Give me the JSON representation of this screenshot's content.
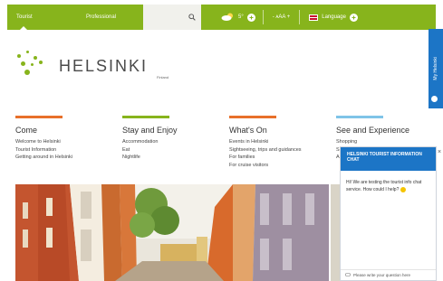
{
  "topbar": {
    "tabs": [
      {
        "label": "Tourist"
      },
      {
        "label": "Professional"
      }
    ],
    "search": {
      "placeholder": ""
    },
    "weather": {
      "temp": "5°"
    },
    "textsize": {
      "label": "- ᴀAA +"
    },
    "language": {
      "label": "Language"
    }
  },
  "side_panel": {
    "label": "My Helsinki"
  },
  "logo": {
    "wordmark": "HELSINKI",
    "sub": "Finland"
  },
  "columns": [
    {
      "title": "Come",
      "color": "#e8702a",
      "links": [
        "Welcome to Helsinki",
        "Tourist Information",
        "Getting around in Helsinki"
      ]
    },
    {
      "title": "Stay and Enjoy",
      "color": "#87b41c",
      "links": [
        "Accommodation",
        "Eat",
        "Nightlife"
      ]
    },
    {
      "title": "What's On",
      "color": "#e8702a",
      "links": [
        "Events in Helsinki",
        "Sightseeing, trips and guidances",
        "For families",
        "For cruise visitors"
      ]
    },
    {
      "title": "See and Experience",
      "color": "#7fc4e8",
      "links": [
        "Shopping",
        "S",
        "A"
      ]
    }
  ],
  "chat": {
    "header": "HELSINKI TOURIST INFORMATION CHAT",
    "message": "Hi! We are testing the tourist info chat service. How could I help?",
    "input_placeholder": "Please write your question here",
    "close": "×"
  },
  "colors": {
    "brand_green": "#87b41c",
    "chat_blue": "#1c75c6",
    "orange": "#e8702a",
    "light_blue": "#7fc4e8"
  }
}
